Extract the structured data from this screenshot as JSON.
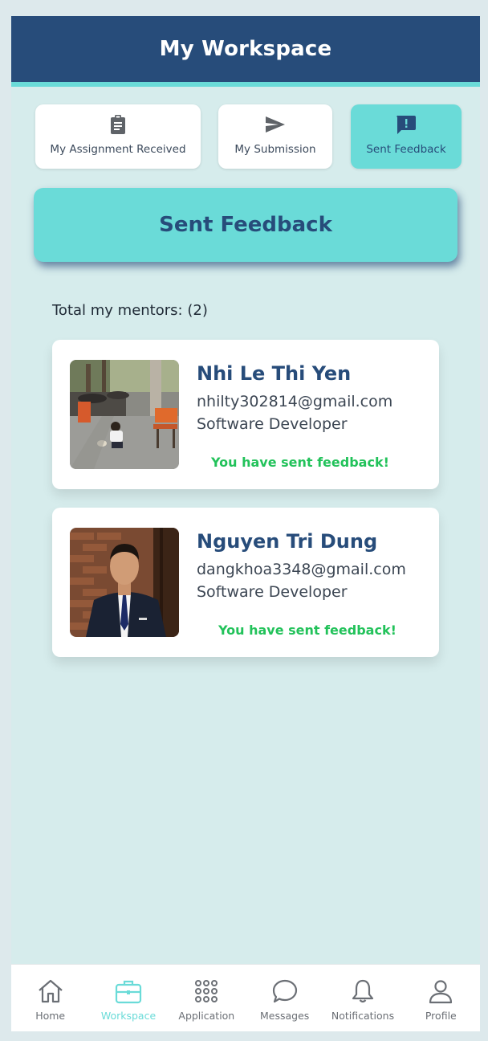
{
  "header": {
    "title": "My Workspace"
  },
  "tabs": [
    {
      "label": "My Assignment Received",
      "icon": "clipboard-icon",
      "active": false
    },
    {
      "label": "My Submission",
      "icon": "send-icon",
      "active": false
    },
    {
      "label": "Sent Feedback",
      "icon": "feedback-icon",
      "active": true
    }
  ],
  "section": {
    "title": "Sent Feedback"
  },
  "summary": {
    "label": "Total my mentors:",
    "count": "(2)"
  },
  "mentors": [
    {
      "name": "Nhi Le Thi Yen",
      "email": "nhilty302814@gmail.com",
      "role": "Software Developer",
      "status": "You have sent feedback!",
      "photo": "street-photo"
    },
    {
      "name": "Nguyen Tri Dung",
      "email": "dangkhoa3348@gmail.com",
      "role": "Software Developer",
      "status": "You have sent feedback!",
      "photo": "portrait-photo"
    }
  ],
  "nav": [
    {
      "label": "Home",
      "icon": "home-icon",
      "active": false
    },
    {
      "label": "Workspace",
      "icon": "briefcase-icon",
      "active": true
    },
    {
      "label": "Application",
      "icon": "apps-grid-icon",
      "active": false
    },
    {
      "label": "Messages",
      "icon": "chat-bubble-icon",
      "active": false
    },
    {
      "label": "Notifications",
      "icon": "bell-icon",
      "active": false
    },
    {
      "label": "Profile",
      "icon": "user-icon",
      "active": false
    }
  ],
  "colors": {
    "header": "#274c7a",
    "accent": "#6adbd8",
    "background": "#d6ecec",
    "success": "#22c25a"
  }
}
